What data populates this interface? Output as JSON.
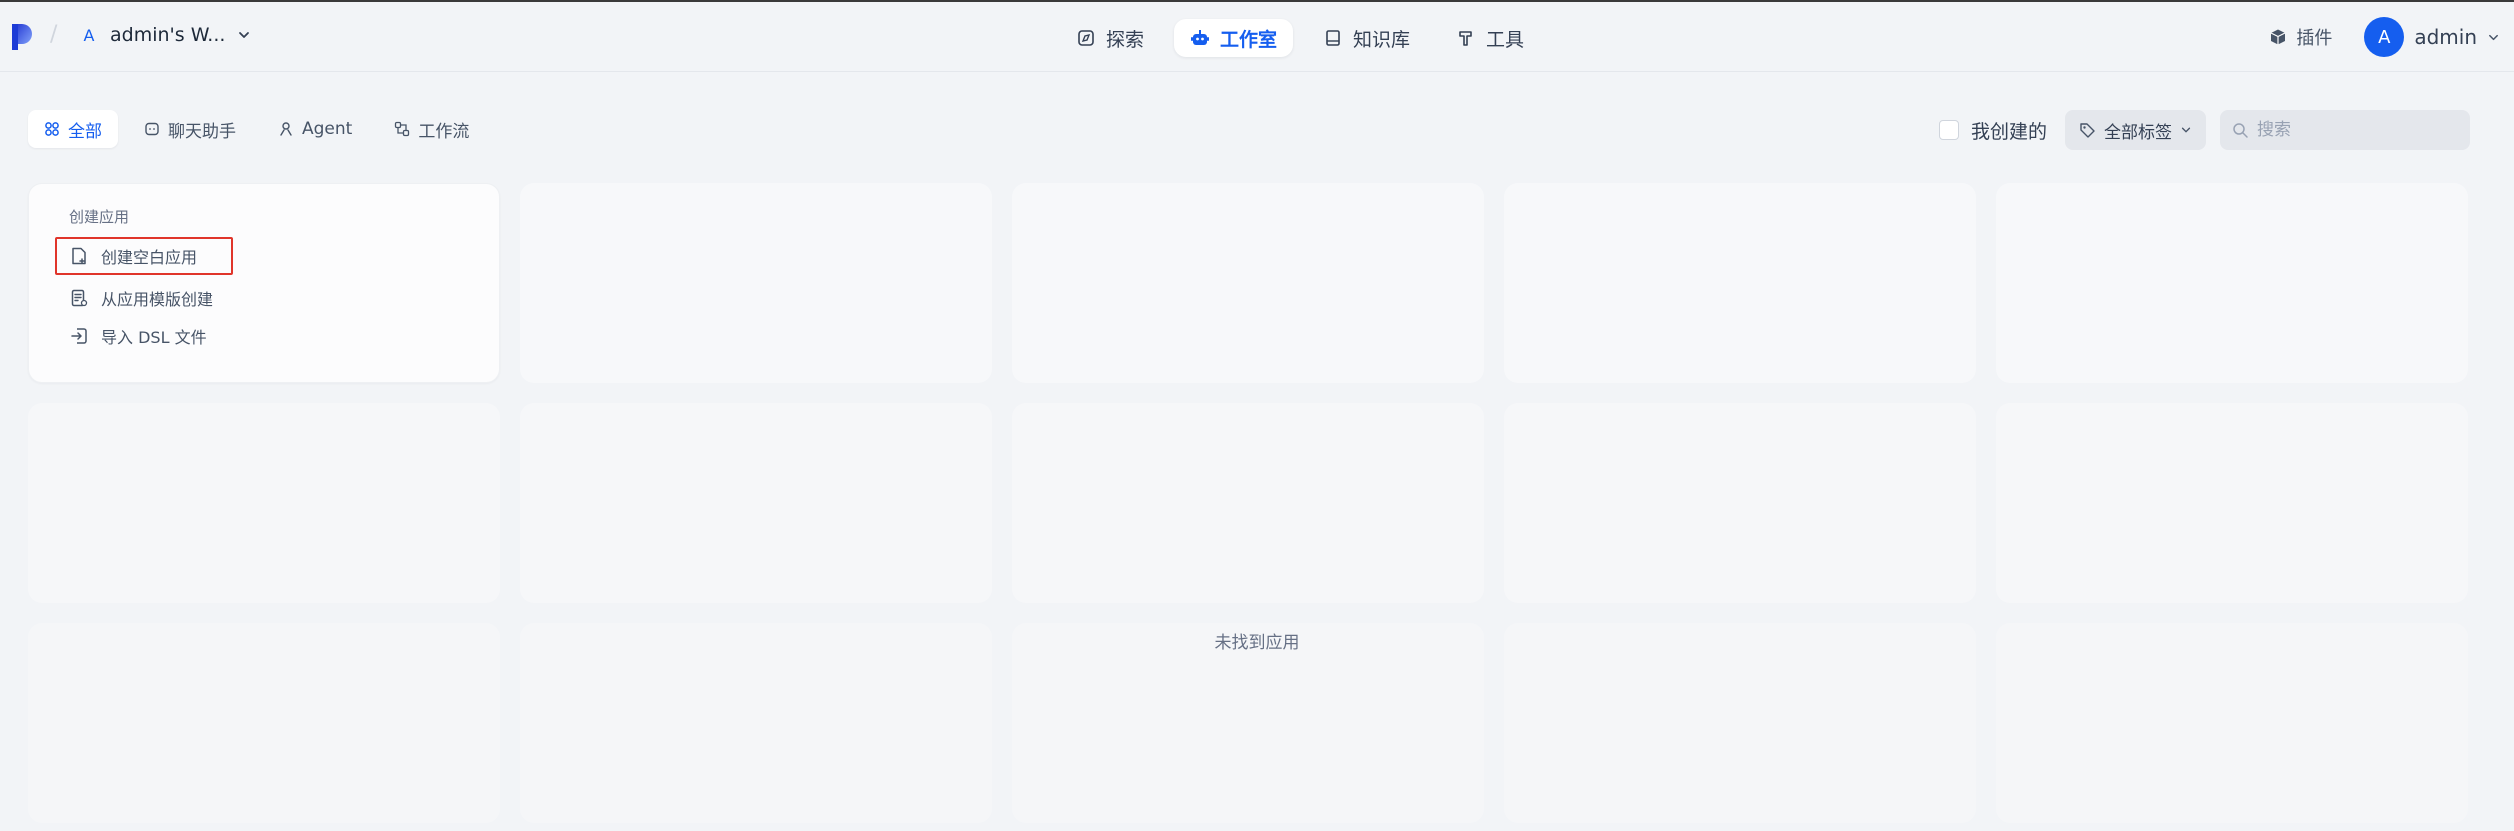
{
  "header": {
    "workspace_letter": "A",
    "workspace_name": "admin's W...",
    "nav": [
      {
        "label": "探索",
        "icon": "explore-icon"
      },
      {
        "label": "工作室",
        "icon": "robot-icon",
        "active": true
      },
      {
        "label": "知识库",
        "icon": "book-icon"
      },
      {
        "label": "工具",
        "icon": "hammer-icon"
      }
    ],
    "plugin_label": "插件",
    "avatar_letter": "A",
    "account_name": "admin"
  },
  "tabs": [
    {
      "label": "全部",
      "icon": "grid-icon",
      "active": true
    },
    {
      "label": "聊天助手",
      "icon": "chat-icon"
    },
    {
      "label": "Agent",
      "icon": "agent-icon"
    },
    {
      "label": "工作流",
      "icon": "workflow-icon"
    }
  ],
  "filters": {
    "mine_label": "我创建的",
    "mine_checked": false,
    "tags_label": "全部标签",
    "search_placeholder": "搜索"
  },
  "create_card": {
    "title": "创建应用",
    "items": [
      {
        "label": "创建空白应用",
        "icon": "blank-file-icon",
        "highlighted": true
      },
      {
        "label": "从应用模版创建",
        "icon": "template-icon"
      },
      {
        "label": "导入 DSL 文件",
        "icon": "import-icon"
      }
    ]
  },
  "empty_state": "未找到应用",
  "colors": {
    "accent": "#155eef",
    "highlight_border": "#e0352b",
    "background": "#f2f4f7"
  }
}
